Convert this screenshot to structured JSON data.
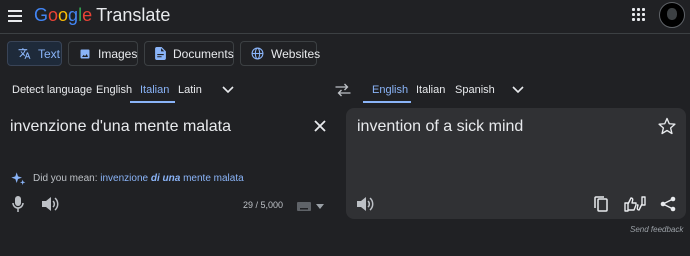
{
  "header": {
    "logo_google": [
      "G",
      "o",
      "o",
      "g",
      "l",
      "e"
    ],
    "logo_product": "Translate"
  },
  "modes": [
    {
      "label": "Text",
      "icon": "translate-icon",
      "active": true
    },
    {
      "label": "Images",
      "icon": "image-icon",
      "active": false
    },
    {
      "label": "Documents",
      "icon": "document-icon",
      "active": false
    },
    {
      "label": "Websites",
      "icon": "globe-icon",
      "active": false
    }
  ],
  "source_langs": [
    {
      "label": "Detect language",
      "active": false
    },
    {
      "label": "English",
      "active": false
    },
    {
      "label": "Italian",
      "active": true
    },
    {
      "label": "Latin",
      "active": false
    }
  ],
  "target_langs": [
    {
      "label": "English",
      "active": true
    },
    {
      "label": "Italian",
      "active": false
    },
    {
      "label": "Spanish",
      "active": false
    }
  ],
  "source": {
    "text": "invenzione d'una mente malata",
    "did_you_mean_label": "Did you mean:",
    "suggestion_before": "invenzione ",
    "suggestion_bold": "di una",
    "suggestion_after": " mente malata",
    "char_count": "29 / 5,000"
  },
  "target": {
    "text": "invention of a sick mind"
  },
  "footer": {
    "send_feedback": "Send feedback"
  },
  "colors": {
    "background": "#202124",
    "accent": "#8ab4f8",
    "panel": "#303134"
  }
}
